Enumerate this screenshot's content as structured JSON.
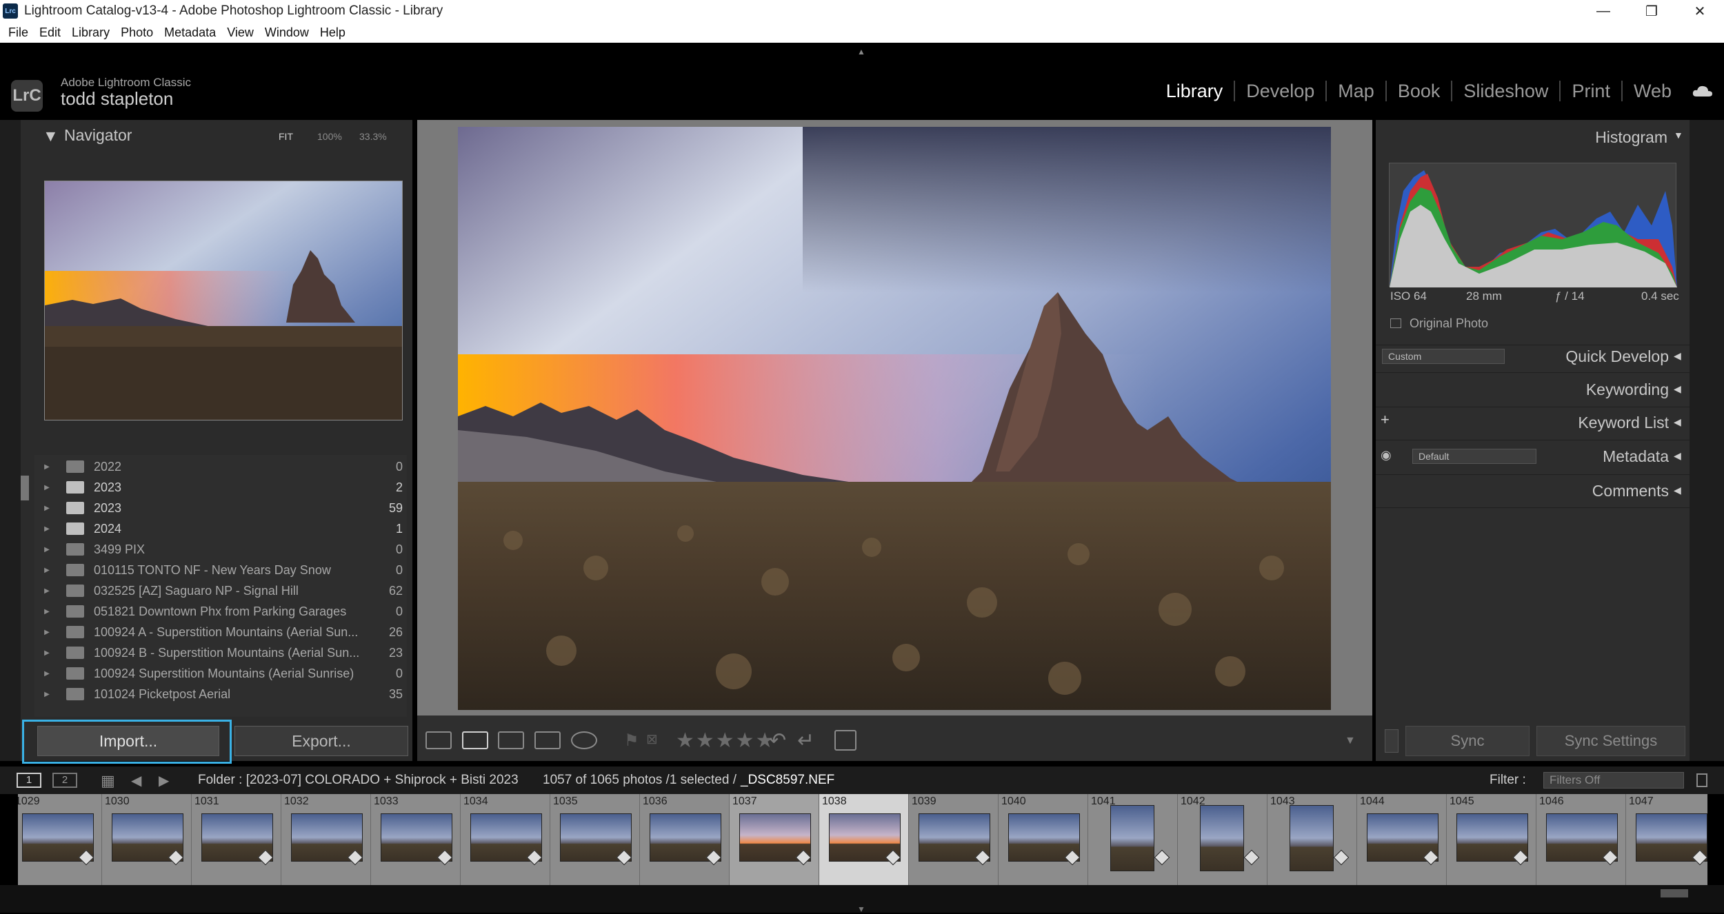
{
  "window": {
    "title": "Lightroom Catalog-v13-4 - Adobe Photoshop Lightroom Classic - Library",
    "app_icon": "Lrc",
    "minimize": "—",
    "maximize": "❐",
    "close": "✕"
  },
  "menu": [
    "File",
    "Edit",
    "Library",
    "Photo",
    "Metadata",
    "View",
    "Window",
    "Help"
  ],
  "identity": {
    "badge": "LrC",
    "product": "Adobe Lightroom Classic",
    "user": "todd stapleton"
  },
  "modules": [
    "Library",
    "Develop",
    "Map",
    "Book",
    "Slideshow",
    "Print",
    "Web"
  ],
  "active_module": "Library",
  "navigator": {
    "title": "Navigator",
    "zoom_fit": "FIT",
    "zoom_100": "100%",
    "zoom_custom": "33.3%"
  },
  "folders": [
    {
      "name": "2022",
      "count": "0",
      "populated": false
    },
    {
      "name": "2023",
      "count": "2",
      "populated": true
    },
    {
      "name": "2023",
      "count": "59",
      "populated": true
    },
    {
      "name": "2024",
      "count": "1",
      "populated": true
    },
    {
      "name": "3499 PIX",
      "count": "0",
      "populated": false
    },
    {
      "name": "010115 TONTO NF - New Years Day Snow",
      "count": "0",
      "populated": false
    },
    {
      "name": "032525 [AZ] Saguaro NP - Signal Hill",
      "count": "62",
      "populated": false
    },
    {
      "name": "051821 Downtown Phx from Parking Garages",
      "count": "0",
      "populated": false
    },
    {
      "name": "100924 A - Superstition Mountains (Aerial Sun...",
      "count": "26",
      "populated": false
    },
    {
      "name": "100924 B - Superstition Mountains (Aerial Sun...",
      "count": "23",
      "populated": false
    },
    {
      "name": "100924 Superstition Mountains (Aerial Sunrise)",
      "count": "0",
      "populated": false
    },
    {
      "name": "101024 Picketpost Aerial",
      "count": "35",
      "populated": false
    }
  ],
  "buttons": {
    "import": "Import...",
    "export": "Export...",
    "sync": "Sync",
    "sync_settings": "Sync Settings"
  },
  "histogram": {
    "title": "Histogram",
    "iso": "ISO 64",
    "focal": "28 mm",
    "aperture": "ƒ / 14",
    "shutter": "0.4 sec",
    "original_photo": "Original Photo"
  },
  "right_sections": {
    "quick_develop": "Quick Develop",
    "quick_develop_preset": "Custom",
    "keywording": "Keywording",
    "keyword_list": "Keyword List",
    "metadata": "Metadata",
    "metadata_preset": "Default",
    "comments": "Comments"
  },
  "filmstrip": {
    "page1": "1",
    "page2": "2",
    "folder": "Folder : [2023-07] COLORADO + Shiprock + Bisti 2023",
    "count": "1057 of 1065 photos /1 selected /",
    "filename": "_DSC8597.NEF",
    "filter_label": "Filter :",
    "filter_value": "Filters Off",
    "thumbs": [
      "1029",
      "1030",
      "1031",
      "1032",
      "1033",
      "1034",
      "1035",
      "1036",
      "1037",
      "1038",
      "1039",
      "1040",
      "1041",
      "1042",
      "1043",
      "1044",
      "1045",
      "1046",
      "1047"
    ]
  },
  "colors": {
    "accent_highlight": "#3ab2e6",
    "panel_bg": "#2b2b2b",
    "active_module": "#ffffff"
  }
}
